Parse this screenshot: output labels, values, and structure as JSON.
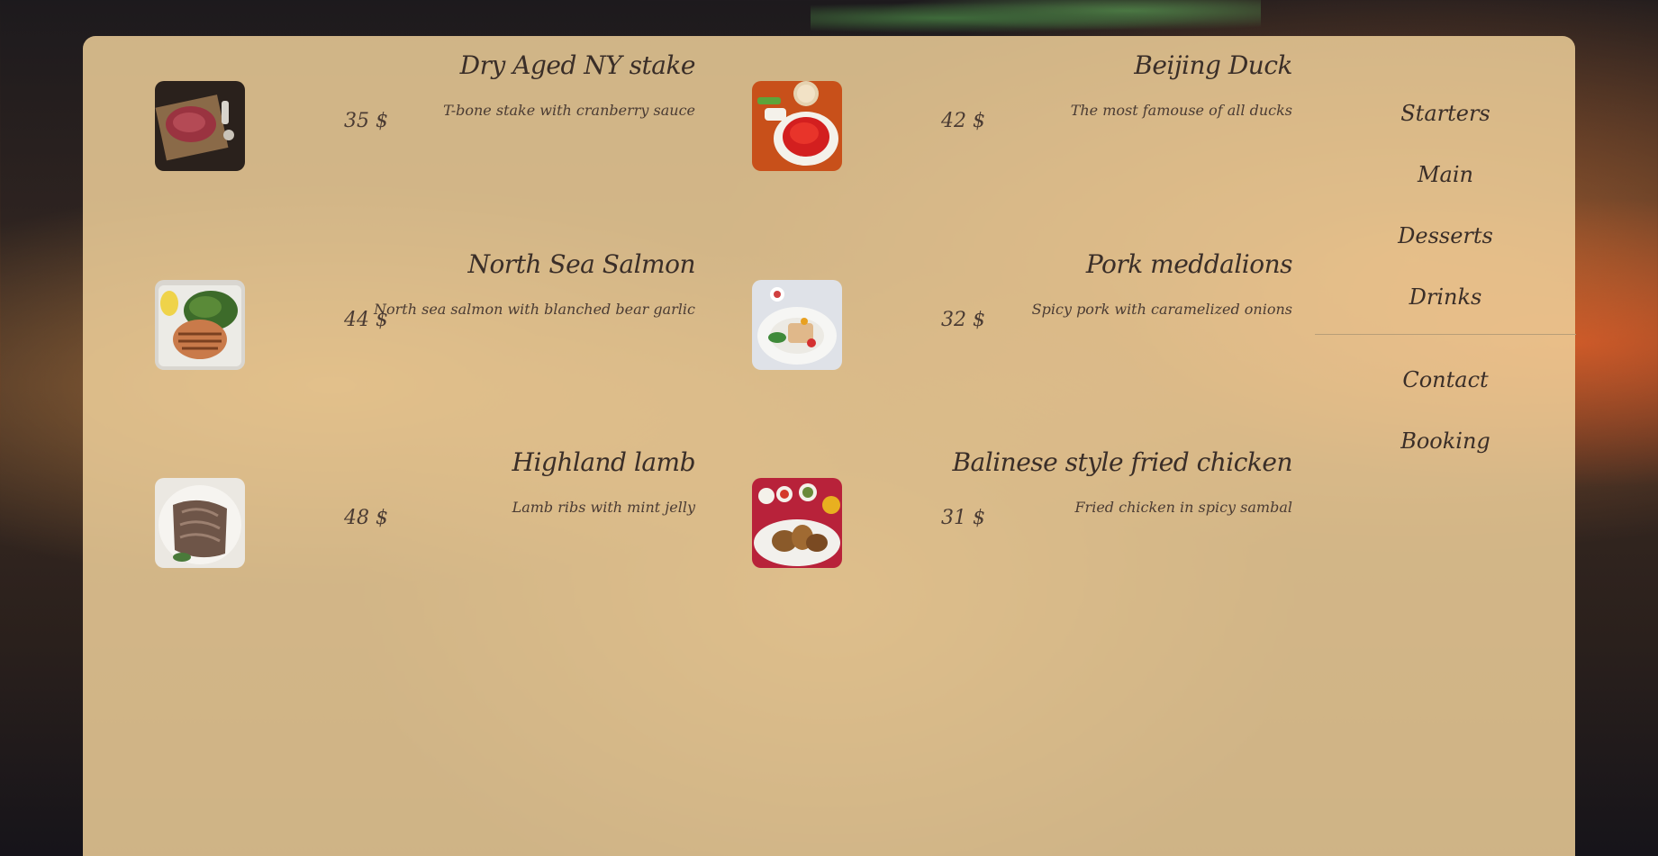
{
  "menu": {
    "dishes": [
      {
        "name": "Dry Aged NY stake",
        "description": "T-bone stake with cranberry sauce",
        "price": "35 $",
        "photo_icon": "steak-photo"
      },
      {
        "name": "Beijing Duck",
        "description": "The most famouse of all ducks",
        "price": "42 $",
        "photo_icon": "duck-photo"
      },
      {
        "name": "North Sea Salmon",
        "description": "North sea salmon with blanched bear garlic",
        "price": "44 $",
        "photo_icon": "salmon-photo"
      },
      {
        "name": "Pork meddalions",
        "description": "Spicy pork with caramelized onions",
        "price": "32 $",
        "photo_icon": "pork-photo"
      },
      {
        "name": "Highland lamb",
        "description": "Lamb ribs with mint jelly",
        "price": "48 $",
        "photo_icon": "lamb-photo"
      },
      {
        "name": "Balinese style fried chicken",
        "description": "Fried chicken in spicy sambal",
        "price": "31 $",
        "photo_icon": "chicken-photo"
      }
    ]
  },
  "nav": {
    "items": [
      "Starters",
      "Main",
      "Desserts",
      "Drinks"
    ],
    "secondary": [
      "Contact",
      "Booking"
    ]
  },
  "colors": {
    "panel": "#eece98",
    "text": "#3a2e28"
  }
}
